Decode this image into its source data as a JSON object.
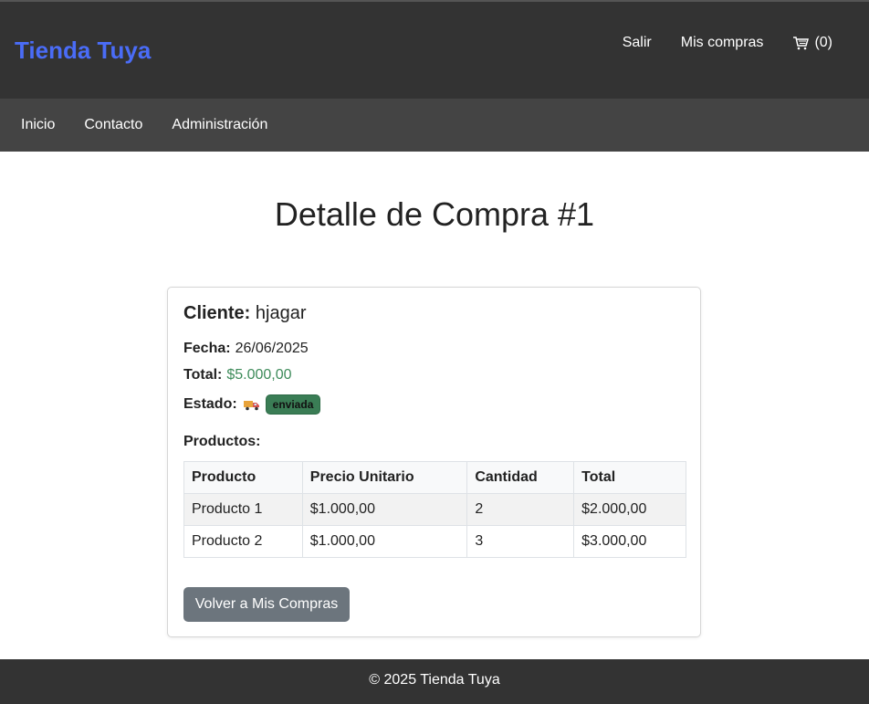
{
  "header": {
    "brand": "Tienda Tuya",
    "links": {
      "logout": "Salir",
      "purchases": "Mis compras",
      "cart": "(0)"
    }
  },
  "nav": {
    "items": [
      "Inicio",
      "Contacto",
      "Administración"
    ]
  },
  "page": {
    "title": "Detalle de Compra #1"
  },
  "order": {
    "client_label": "Cliente:",
    "client": "hjagar",
    "date_label": "Fecha:",
    "date": "26/06/2025",
    "total_label": "Total:",
    "total": "$5.000,00",
    "status_label": "Estado:",
    "status": "enviada",
    "status_color": "#3a7d55",
    "products_label": "Productos:",
    "table": {
      "headers": [
        "Producto",
        "Precio Unitario",
        "Cantidad",
        "Total"
      ],
      "rows": [
        [
          "Producto 1",
          "$1.000,00",
          "2",
          "$2.000,00"
        ],
        [
          "Producto 2",
          "$1.000,00",
          "3",
          "$3.000,00"
        ]
      ]
    },
    "back_button": "Volver a Mis Compras"
  },
  "footer": {
    "text": "© 2025 Tienda Tuya"
  },
  "colors": {
    "brand": "#4a6cf7",
    "header_bg": "#333333",
    "nav_bg": "#444444",
    "button": "#6c757d",
    "total": "#3d8b5a"
  }
}
